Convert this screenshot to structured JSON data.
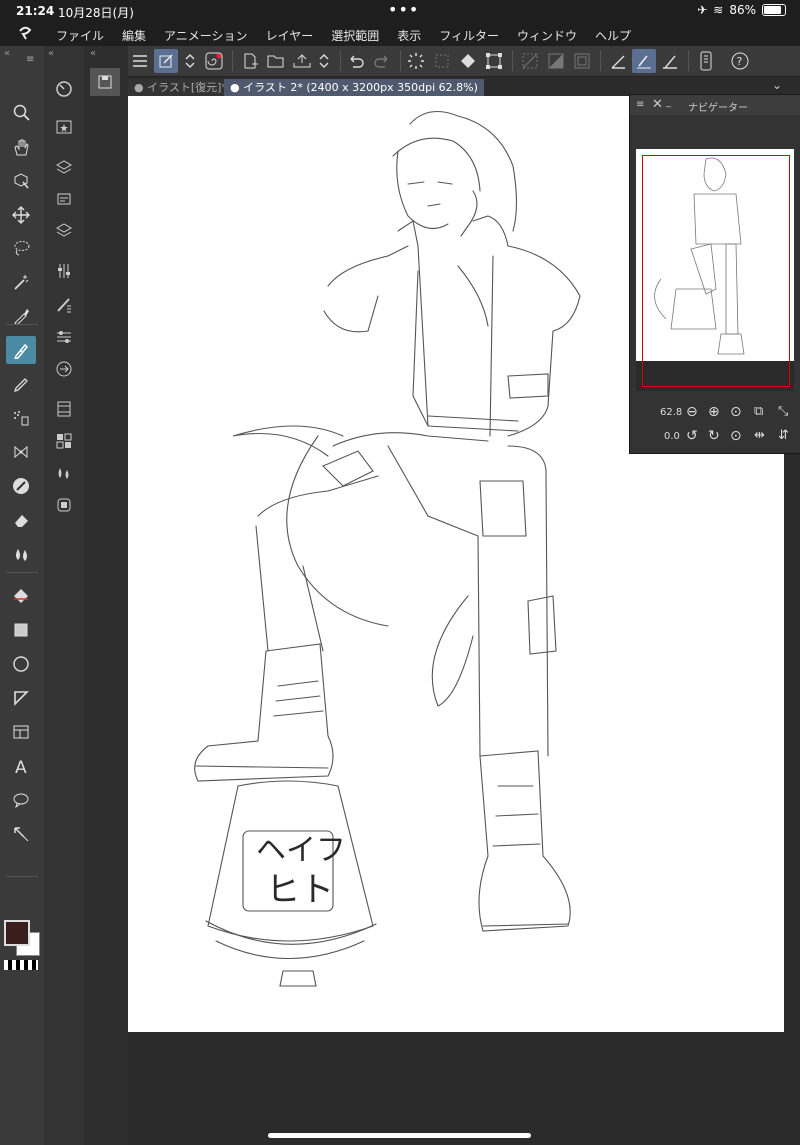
{
  "status": {
    "time": "21:24",
    "date": "10月28日(月)",
    "battery": "86%",
    "battery_level": 0.86
  },
  "menu": {
    "items": [
      "ファイル",
      "編集",
      "アニメーション",
      "レイヤー",
      "選択範囲",
      "表示",
      "フィルター",
      "ウィンドウ",
      "ヘルプ"
    ]
  },
  "tabs": [
    {
      "label": "● イラスト[復元]*"
    },
    {
      "label": "● イラスト 2* (2400 x 3200px 350dpi 62.8%)"
    }
  ],
  "navigator": {
    "title": "ナビゲーター",
    "zoom": "62.8",
    "rotation": "0.0"
  },
  "tools": {
    "left": [
      "zoom-icon",
      "hand-icon",
      "object-icon",
      "move-icon",
      "lasso-icon",
      "magic-wand-icon",
      "eyedropper-icon",
      "pen-icon",
      "pencil-icon",
      "airbrush-icon",
      "decoration-icon",
      "brush-icon",
      "eraser-icon",
      "blend-icon",
      "fill-icon",
      "gradient-icon",
      "ellipse-icon",
      "ruler-icon",
      "frame-icon",
      "text-icon",
      "balloon-icon",
      "correct-line-icon"
    ],
    "colors": {
      "main": "#3a1d1d",
      "sub": "#ffffff",
      "accent": "#4b8aa3"
    }
  },
  "canvas_label": {
    "line1": "ヘイフ",
    "line2": "ヒト"
  }
}
